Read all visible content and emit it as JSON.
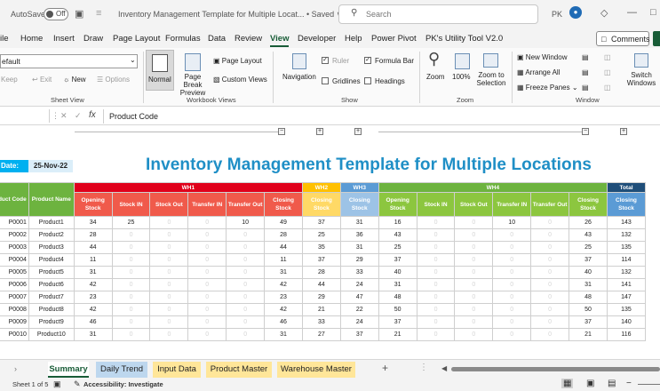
{
  "titlebar": {
    "autosave_label": "AutoSave",
    "autosave_state": "Off",
    "doc_title": "Inventory Management Template for Multiple Locat... • Saved ∨",
    "search_placeholder": "Search",
    "user_initials": "PK"
  },
  "menu": {
    "items": [
      "ile",
      "Home",
      "Insert",
      "Draw",
      "Page Layout",
      "Formulas",
      "Data",
      "Review",
      "View",
      "Developer",
      "Help",
      "Power Pivot",
      "PK's Utility Tool V2.0"
    ],
    "active": "View",
    "comments_label": "Comments"
  },
  "ribbon": {
    "sheet_view": {
      "selected": "efault",
      "keep": "Keep",
      "exit": "Exit",
      "new": "New",
      "options": "Options",
      "label": "Sheet View"
    },
    "workbook_views": {
      "normal": "Normal",
      "page_break": "Page Break\nPreview",
      "page_layout": "Page Layout",
      "custom_views": "Custom Views",
      "label": "Workbook Views"
    },
    "show": {
      "navigation": "Navigation",
      "ruler": "Ruler",
      "formula_bar": "Formula Bar",
      "gridlines": "Gridlines",
      "headings": "Headings",
      "label": "Show",
      "ruler_checked": true,
      "formula_bar_checked": true,
      "gridlines_checked": false,
      "headings_checked": false
    },
    "zoom": {
      "zoom": "Zoom",
      "hundred": "100%",
      "zoom_to_selection": "Zoom to\nSelection",
      "label": "Zoom"
    },
    "window": {
      "new_window": "New Window",
      "arrange_all": "Arrange All",
      "freeze_panes": "Freeze Panes",
      "switch_windows": "Switch\nWindows",
      "label": "Window"
    }
  },
  "formula_bar": {
    "fx": "fx",
    "content": "Product Code"
  },
  "sheet": {
    "date_label": "Date:",
    "date_value": "25-Nov-22",
    "title": "Inventory Management Template for Multiple Locations",
    "group_headers": {
      "wh1": "WH1",
      "wh2": "WH2",
      "wh3": "WH3",
      "wh4": "WH4",
      "total": "Total"
    },
    "col_headers": {
      "product_code": "Product Code",
      "product_name": "Product Name",
      "opening": "Opening Stock",
      "stock_in": "Stock IN",
      "stock_out": "Stock Out",
      "transfer_in": "Transfer IN",
      "transfer_out": "Transfer Out",
      "closing": "Closing Stock"
    },
    "rows": [
      {
        "code": "P0001",
        "name": "Product1",
        "v": [
          34,
          25,
          0,
          0,
          10,
          49,
          37,
          31,
          16,
          0,
          0,
          10,
          0,
          26,
          143
        ]
      },
      {
        "code": "P0002",
        "name": "Product2",
        "v": [
          28,
          0,
          0,
          0,
          0,
          28,
          25,
          36,
          43,
          0,
          0,
          0,
          0,
          43,
          132
        ]
      },
      {
        "code": "P0003",
        "name": "Product3",
        "v": [
          44,
          0,
          0,
          0,
          0,
          44,
          35,
          31,
          25,
          0,
          0,
          0,
          0,
          25,
          135
        ]
      },
      {
        "code": "P0004",
        "name": "Product4",
        "v": [
          11,
          0,
          0,
          0,
          0,
          11,
          37,
          29,
          37,
          0,
          0,
          0,
          0,
          37,
          114
        ]
      },
      {
        "code": "P0005",
        "name": "Product5",
        "v": [
          31,
          0,
          0,
          0,
          0,
          31,
          28,
          33,
          40,
          0,
          0,
          0,
          0,
          40,
          132
        ]
      },
      {
        "code": "P0006",
        "name": "Product6",
        "v": [
          42,
          0,
          0,
          0,
          0,
          42,
          44,
          24,
          31,
          0,
          0,
          0,
          0,
          31,
          141
        ]
      },
      {
        "code": "P0007",
        "name": "Product7",
        "v": [
          23,
          0,
          0,
          0,
          0,
          23,
          29,
          47,
          48,
          0,
          0,
          0,
          0,
          48,
          147
        ]
      },
      {
        "code": "P0008",
        "name": "Product8",
        "v": [
          42,
          0,
          0,
          0,
          0,
          42,
          21,
          22,
          50,
          0,
          0,
          0,
          0,
          50,
          135
        ]
      },
      {
        "code": "P0009",
        "name": "Product9",
        "v": [
          46,
          0,
          0,
          0,
          0,
          46,
          33,
          24,
          37,
          0,
          0,
          0,
          0,
          37,
          140
        ]
      },
      {
        "code": "P0010",
        "name": "Product10",
        "v": [
          31,
          0,
          0,
          0,
          0,
          31,
          27,
          37,
          21,
          0,
          0,
          0,
          0,
          21,
          116
        ]
      }
    ]
  },
  "tabs": [
    {
      "label": "Summary",
      "style": "active"
    },
    {
      "label": "Daily Trend",
      "style": "blue"
    },
    {
      "label": "Input Data",
      "style": "yellow"
    },
    {
      "label": "Product Master",
      "style": "yellow"
    },
    {
      "label": "Warehouse Master",
      "style": "yellow"
    }
  ],
  "status": {
    "sheet_info": "Sheet 1 of 5",
    "accessibility": "Accessibility: Investigate"
  },
  "colors": {
    "brand_green": "#185c37",
    "title_blue": "#1f8fc6",
    "wh1_red": "#e0001b",
    "wh2_yellow": "#ffc000",
    "wh3_blue": "#5b9bd5",
    "wh4_green": "#6db33f",
    "total_navy": "#1f4e79"
  }
}
